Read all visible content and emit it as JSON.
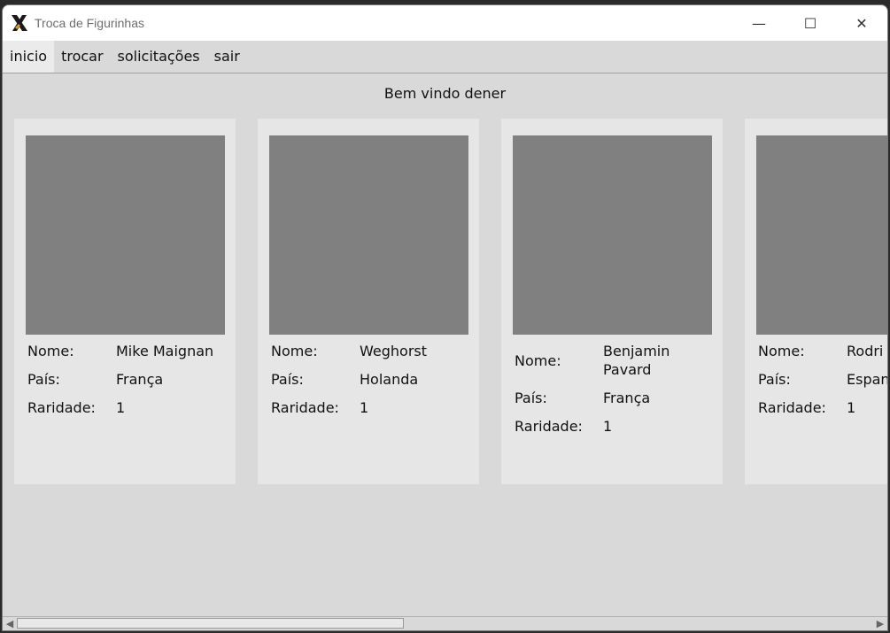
{
  "window": {
    "title": "Troca de Figurinhas",
    "controls": {
      "minimize": "—",
      "maximize": "☐",
      "close": "✕"
    }
  },
  "menu": [
    {
      "label": "inicio",
      "active": true
    },
    {
      "label": "trocar",
      "active": false
    },
    {
      "label": "solicitações",
      "active": false
    },
    {
      "label": "sair",
      "active": false
    }
  ],
  "welcome": "Bem vindo dener",
  "labels": {
    "name": "Nome:",
    "country": "País:",
    "rarity": "Raridade:"
  },
  "cards": [
    {
      "name": "Mike Maignan",
      "country": "França",
      "rarity": "1"
    },
    {
      "name": "Weghorst",
      "country": "Holanda",
      "rarity": "1"
    },
    {
      "name": "Benjamin Pavard",
      "country": "França",
      "rarity": "1"
    },
    {
      "name": "Rodri",
      "country": "Espanha",
      "rarity": "1"
    }
  ],
  "scrollbar": {
    "left_arrow": "◀",
    "right_arrow": "▶"
  },
  "colors": {
    "photo_placeholder": "#808080",
    "card_bg": "#e6e6e7",
    "window_bg": "#d9d9d9"
  }
}
